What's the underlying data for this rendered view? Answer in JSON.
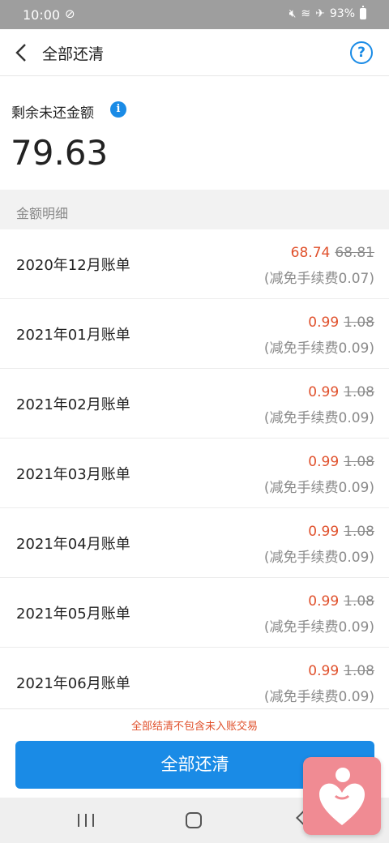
{
  "status_bar": {
    "time": "10:00",
    "battery": "93%",
    "icons": [
      "do-not-disturb-icon",
      "mute-icon",
      "wifi-icon",
      "airplane-icon",
      "battery-icon"
    ]
  },
  "header": {
    "title": "全部还清",
    "back_icon": "chevron-left-icon",
    "help_label": "?"
  },
  "summary": {
    "label": "剩余未还金额",
    "info_label": "i",
    "amount": "79.63"
  },
  "section_label": "金额明细",
  "bills": [
    {
      "name": "2020年12月账单",
      "amount": "68.74",
      "original": "68.81",
      "fee": "(减免手续费0.07)"
    },
    {
      "name": "2021年01月账单",
      "amount": "0.99",
      "original": "1.08",
      "fee": "(减免手续费0.09)"
    },
    {
      "name": "2021年02月账单",
      "amount": "0.99",
      "original": "1.08",
      "fee": "(减免手续费0.09)"
    },
    {
      "name": "2021年03月账单",
      "amount": "0.99",
      "original": "1.08",
      "fee": "(减免手续费0.09)"
    },
    {
      "name": "2021年04月账单",
      "amount": "0.99",
      "original": "1.08",
      "fee": "(减免手续费0.09)"
    },
    {
      "name": "2021年05月账单",
      "amount": "0.99",
      "original": "1.08",
      "fee": "(减免手续费0.09)"
    },
    {
      "name": "2021年06月账单",
      "amount": "0.99",
      "original": "1.08",
      "fee": "(减免手续费0.09)"
    }
  ],
  "footer": {
    "notice": "全部结清不包含未入账交易",
    "button_label": "全部还清"
  },
  "colors": {
    "accent": "#1a8be6",
    "discount": "#e0502b",
    "muted": "#8a8a8a"
  }
}
